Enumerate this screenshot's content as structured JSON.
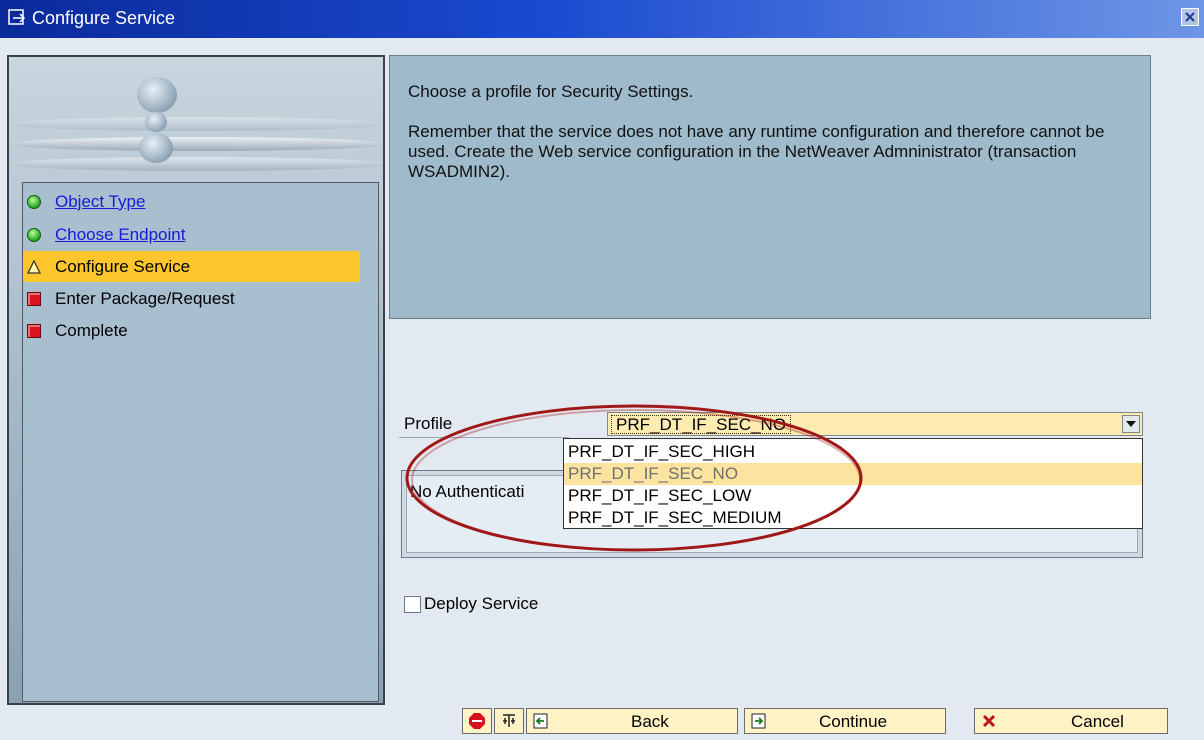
{
  "window": {
    "title": "Configure Service"
  },
  "wizard": {
    "steps": [
      {
        "label": "Object Type",
        "status": "done",
        "link": true
      },
      {
        "label": "Choose Endpoint",
        "status": "done",
        "link": true
      },
      {
        "label": "Configure Service",
        "status": "current",
        "link": false
      },
      {
        "label": "Enter Package/Request",
        "status": "pending",
        "link": false
      },
      {
        "label": "Complete",
        "status": "pending",
        "link": false
      }
    ]
  },
  "message": {
    "line1": "Choose a profile for Security Settings.",
    "line2": "Remember that the service does not have any runtime configuration and therefore cannot be used. Create the Web service configuration in the NetWeaver Admninistrator (transaction WSADMIN2)."
  },
  "profile": {
    "label": "Profile",
    "selected": "PRF_DT_IF_SEC_NO",
    "options": [
      "PRF_DT_IF_SEC_HIGH",
      "PRF_DT_IF_SEC_NO",
      "PRF_DT_IF_SEC_LOW",
      "PRF_DT_IF_SEC_MEDIUM"
    ],
    "highlighted_index": 1
  },
  "auth": {
    "text": "No Authenticati"
  },
  "deploy": {
    "label": "Deploy Service",
    "checked": false
  },
  "buttons": {
    "back": "Back",
    "continue": "Continue",
    "cancel": "Cancel"
  },
  "colors": {
    "title_bar": "#0a2a9a",
    "active_step": "#fcc62c",
    "annotation": "#a01818",
    "button_bg": "#fff3c6"
  }
}
